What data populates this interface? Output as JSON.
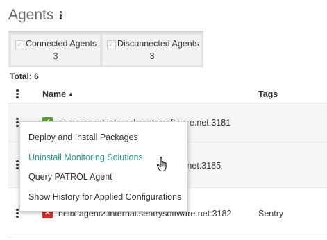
{
  "header": {
    "title": "Agents"
  },
  "filters": [
    {
      "label": "Connected Agents",
      "count": "3"
    },
    {
      "label": "Disconnected Agents",
      "count": "3"
    }
  ],
  "summary": {
    "total_label": "Total: 6"
  },
  "table": {
    "columns": {
      "name": "Name",
      "tags": "Tags"
    },
    "sort": {
      "column": "Name",
      "direction": "ascending"
    },
    "rows": [
      {
        "name": "demo-agent.internal.sentrysoftware.net:3181",
        "tags": "",
        "status": "connected",
        "status_color": "#5a9e2f"
      },
      {
        "name": "...net:3185",
        "tags": "",
        "status": "",
        "status_color": ""
      },
      {
        "name": "helix-agent2.internal.sentrysoftware.net:3182",
        "tags": "Sentry",
        "status": "disconnected",
        "status_color": "#d9302e"
      }
    ]
  },
  "context_menu": {
    "items": [
      {
        "label": "Deploy and Install Packages"
      },
      {
        "label": "Uninstall Monitoring Solutions",
        "hovered": true
      },
      {
        "label": "Query PATROL Agent"
      },
      {
        "label": "Show History for Applied Configurations"
      }
    ]
  },
  "colors": {
    "accent": "#2a9a8e",
    "filter_bar": "#e4e4e4",
    "row_highlight": "#f5f5f5"
  },
  "icons": {
    "more": "kebab-icon",
    "checkbox": "checkbox-icon",
    "sort": "sort-up-icon",
    "cursor": "hand-pointer-icon"
  }
}
